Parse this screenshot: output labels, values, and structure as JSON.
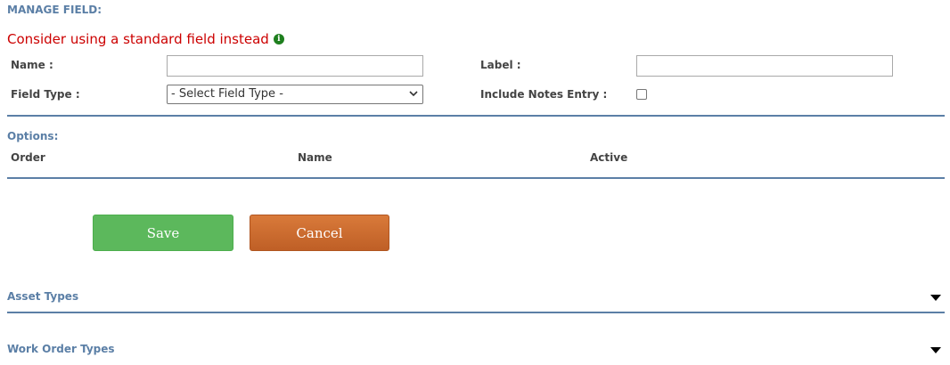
{
  "header": {
    "title": "MANAGE FIELD:",
    "notice": "Consider using a standard field instead"
  },
  "form": {
    "name_label": "Name :",
    "name_value": "",
    "label_label": "Label :",
    "label_value": "",
    "field_type_label": "Field Type :",
    "field_type_selected": "- Select Field Type -",
    "include_notes_label": "Include Notes Entry :",
    "include_notes_checked": false
  },
  "options": {
    "title": "Options:",
    "columns": [
      "Order",
      "Name",
      "Active"
    ]
  },
  "buttons": {
    "save_label": "Save",
    "cancel_label": "Cancel"
  },
  "sections": [
    {
      "label": "Asset Types"
    },
    {
      "label": "Work Order Types"
    }
  ],
  "colors": {
    "accent": "#5b7fa6",
    "notice": "#cc0000",
    "save": "#5cb85c",
    "cancel": "#d0703a"
  },
  "icons": {
    "notice_icon": "info-circle-icon",
    "select_icon": "chevron-down-icon",
    "section_icon": "caret-down-icon"
  }
}
